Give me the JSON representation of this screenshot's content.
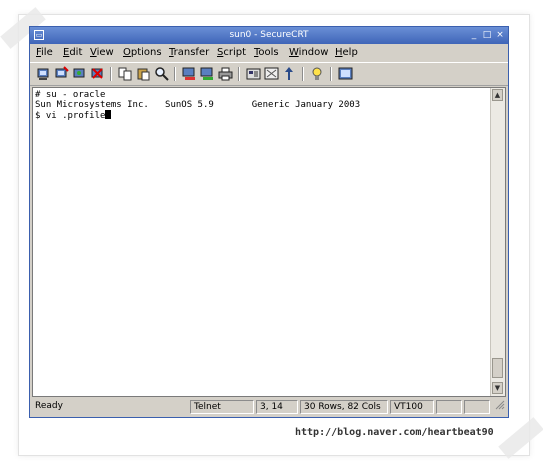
{
  "window": {
    "title": "sun0 - SecureCRT",
    "app_icon": "securecrt-icon",
    "controls": [
      "_",
      "□",
      "×"
    ]
  },
  "menu": [
    "File",
    "Edit",
    "View",
    "Options",
    "Transfer",
    "Script",
    "Tools",
    "Window",
    "Help"
  ],
  "toolbar": {
    "icons": [
      "connect-icon",
      "quick-connect-icon",
      "reconnect-icon",
      "disconnect-icon",
      "copy-icon",
      "paste-icon",
      "find-icon",
      "send-file-icon",
      "receive-file-icon",
      "print-icon",
      "session-options-icon",
      "global-options-icon",
      "keymap-icon",
      "help-icon",
      "about-icon"
    ]
  },
  "terminal": {
    "lines": [
      "# su - oracle",
      "Sun Microsystems Inc.   SunOS 5.9       Generic January 2003",
      "$ vi .profile"
    ]
  },
  "status": {
    "state": "Ready",
    "protocol": "Telnet",
    "cursor_pos": "3,  14",
    "size": "30 Rows, 82 Cols",
    "emulation": "VT100"
  },
  "credit": "http://blog.naver.com/heartbeat90"
}
